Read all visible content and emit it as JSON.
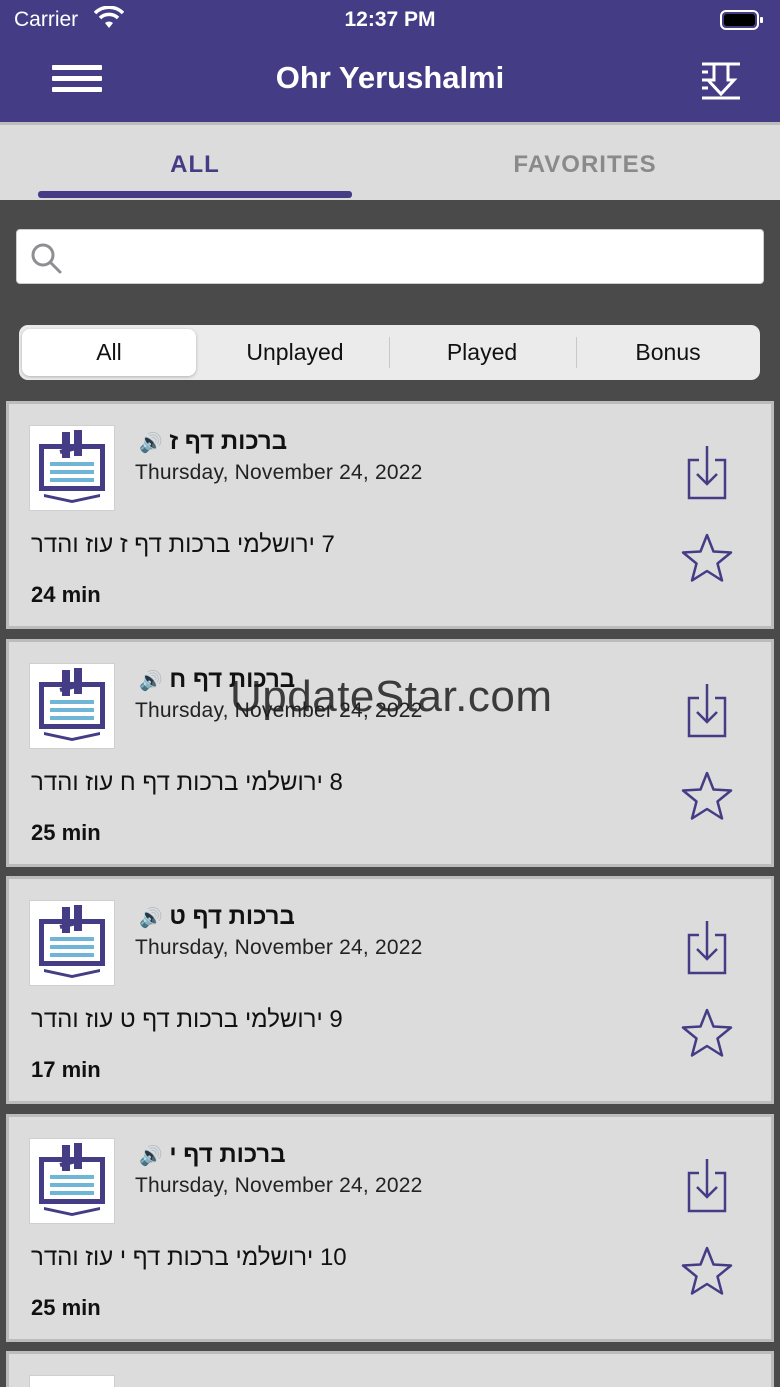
{
  "status_bar": {
    "carrier": "Carrier",
    "time": "12:37 PM"
  },
  "nav": {
    "title": "Ohr Yerushalmi"
  },
  "tabs": [
    {
      "label": "ALL"
    },
    {
      "label": "FAVORITES"
    }
  ],
  "search": {
    "placeholder": ""
  },
  "filters": [
    {
      "label": "All"
    },
    {
      "label": "Unplayed"
    },
    {
      "label": "Played"
    },
    {
      "label": "Bonus"
    }
  ],
  "episodes": [
    {
      "title": "ברכות דף ז",
      "date": "Thursday, November 24, 2022",
      "description": "7 ירושלמי ברכות דף ז עוז והדר",
      "duration": "24 min"
    },
    {
      "title": "ברכות דף ח",
      "date": "Thursday, November 24, 2022",
      "description": "8 ירושלמי ברכות דף ח עוז והדר",
      "duration": "25 min"
    },
    {
      "title": "ברכות דף ט",
      "date": "Thursday, November 24, 2022",
      "description": "9 ירושלמי ברכות דף ט עוז והדר",
      "duration": "17 min"
    },
    {
      "title": "ברכות דף י",
      "date": "Thursday, November 24, 2022",
      "description": "10 ירושלמי ברכות דף י עוז והדר",
      "duration": "25 min"
    }
  ],
  "watermark": "UpdateStar.com",
  "colors": {
    "brand": "#443d85",
    "card_bg": "#dcdcdc",
    "page_bg": "#4a4a4a"
  }
}
